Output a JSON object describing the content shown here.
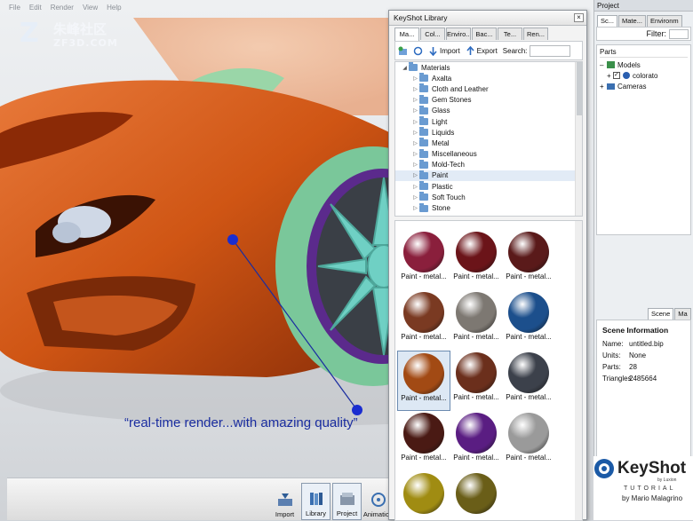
{
  "menu": [
    "File",
    "Edit",
    "Render",
    "View",
    "Help"
  ],
  "watermark": {
    "cn": "朱峰社区",
    "en": "ZF3D.COM"
  },
  "annotation": "“real-time render...with amazing quality”",
  "toolbar": [
    {
      "label": "Import",
      "icon": "import-icon",
      "active": false
    },
    {
      "label": "Library",
      "icon": "library-icon",
      "active": true
    },
    {
      "label": "Project",
      "icon": "project-icon",
      "active": true
    },
    {
      "label": "Animation",
      "icon": "animation-icon",
      "active": false
    }
  ],
  "library": {
    "title": "KeyShot Library",
    "close": "×",
    "tabs": [
      "Ma...",
      "Col...",
      "Enviro...",
      "Bac...",
      "Te...",
      "Ren..."
    ],
    "tools": {
      "import": "Import",
      "export": "Export",
      "search": "Search:"
    },
    "tree_root": "Materials",
    "tree": [
      "Axalta",
      "Cloth and Leather",
      "Gem Stones",
      "Glass",
      "Light",
      "Liquids",
      "Metal",
      "Miscellaneous",
      "Mold-Tech",
      "Paint",
      "Plastic",
      "Soft Touch",
      "Stone"
    ],
    "tree_selected": "Paint",
    "materials": [
      {
        "label": "Paint - metal...",
        "color": "#8a1f3c"
      },
      {
        "label": "Paint - metal...",
        "color": "#6b1419"
      },
      {
        "label": "Paint - metal...",
        "color": "#5a1a1a"
      },
      {
        "label": "Paint - metal...",
        "color": "#7a3a22"
      },
      {
        "label": "Paint - metal...",
        "color": "#7d7872"
      },
      {
        "label": "Paint - metal...",
        "color": "#1c4f8c"
      },
      {
        "label": "Paint - metal...",
        "color": "#a24a14"
      },
      {
        "label": "Paint - metal...",
        "color": "#6b2f1c"
      },
      {
        "label": "Paint - metal...",
        "color": "#3c414b"
      },
      {
        "label": "Paint - metal...",
        "color": "#4a1a14"
      },
      {
        "label": "Paint - metal...",
        "color": "#5a1d82"
      },
      {
        "label": "Paint - metal...",
        "color": "#9a9a9a"
      },
      {
        "label": "",
        "color": "#a08c12"
      },
      {
        "label": "",
        "color": "#6a5e18"
      }
    ],
    "selected_material": 6
  },
  "project": {
    "title": "Project",
    "tabs": [
      "Sc...",
      "Mate...",
      "Environm"
    ],
    "filter": "Filter:",
    "parts_header": "Parts",
    "models": "Models",
    "model_item": "colorato",
    "cameras": "Cameras",
    "scene_tabs": [
      "Scene",
      "Ma"
    ],
    "scene_info_title": "Scene Information",
    "info": [
      {
        "key": "Name:",
        "value": "untitled.bip"
      },
      {
        "key": "Units:",
        "value": "None"
      },
      {
        "key": "Parts:",
        "value": "28"
      },
      {
        "key": "Triangles:",
        "value": "2485664"
      }
    ]
  },
  "branding": {
    "product": "KeyShot",
    "by": "by Luxion",
    "tutorial": "TUTORIAL",
    "author": "by Mario Malagrino"
  },
  "colors": {
    "accent": "#1a2da0",
    "car_paint": "#d2581a",
    "tire": "#7ac79a",
    "wheel": "#6fd0c4"
  }
}
